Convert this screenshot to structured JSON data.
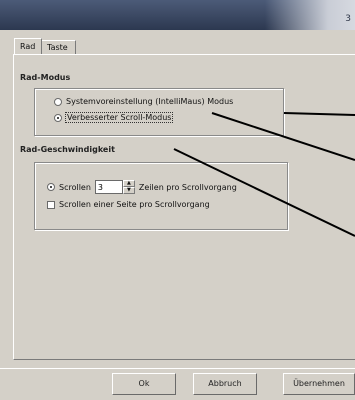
{
  "window": {
    "title_partial": "3"
  },
  "tabs": [
    {
      "label": "Rad",
      "active": true
    },
    {
      "label": "Taste",
      "active": false
    }
  ],
  "rad_modus": {
    "title": "Rad-Modus",
    "options": [
      {
        "label": "Systemvoreinstellung (IntelliMaus) Modus",
        "checked": false
      },
      {
        "label": "Verbesserter Scroll-Modus",
        "checked": true
      }
    ]
  },
  "rad_geschwindigkeit": {
    "title": "Rad-Geschwindigkeit",
    "scroll_option": {
      "label": "Scrollen",
      "checked": true,
      "value": "3",
      "suffix": "Zeilen pro Scrollvorgang"
    },
    "page_option": {
      "label": "Scrollen einer Seite pro Scrollvorgang",
      "checked": false
    }
  },
  "buttons": {
    "ok": "Ok",
    "cancel": "Abbruch",
    "apply": "Übernehmen"
  },
  "colors": {
    "dialog_bg": "#d4d0c8",
    "titlebar": "#3a4660",
    "callout_line": "#000000"
  }
}
